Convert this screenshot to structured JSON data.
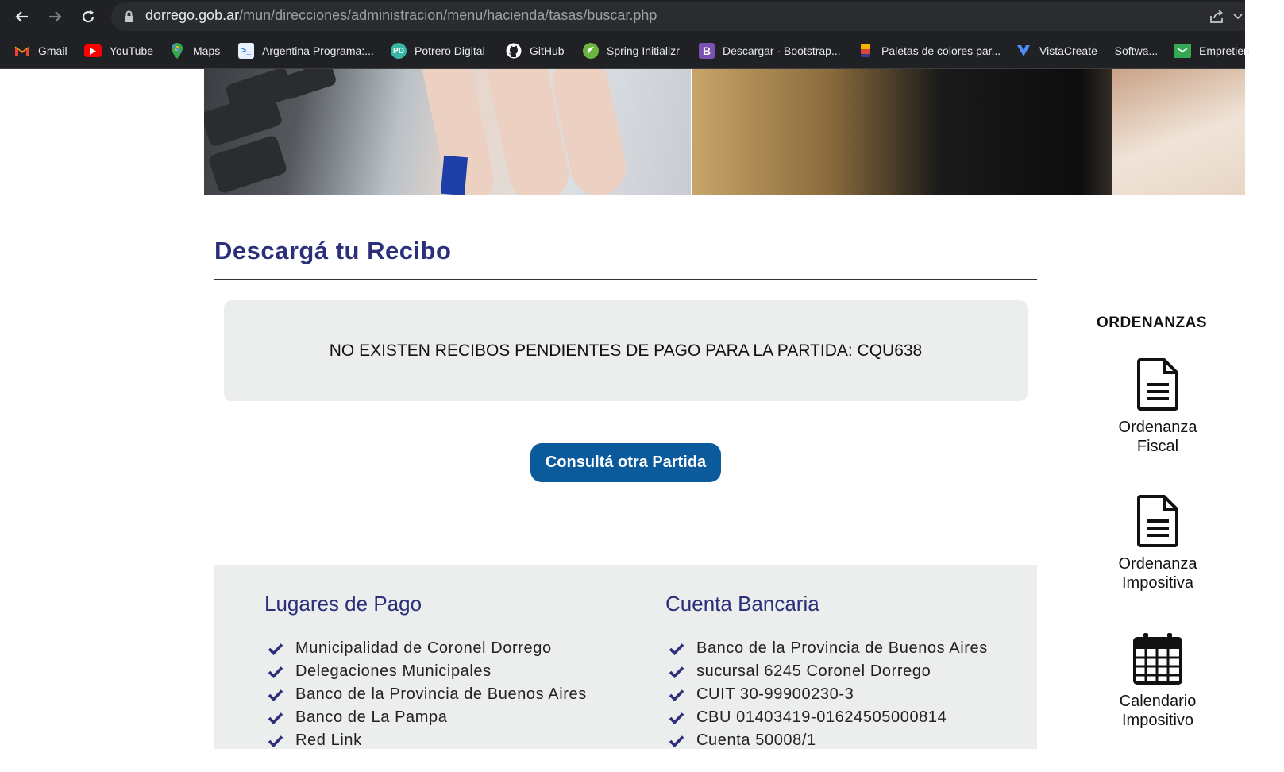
{
  "browser": {
    "url_host": "dorrego.gob.ar",
    "url_path": "/mun/direcciones/administracion/menu/hacienda/tasas/buscar.php",
    "bookmarks": [
      {
        "label": "Gmail",
        "icon": "gmail-icon"
      },
      {
        "label": "YouTube",
        "icon": "youtube-icon"
      },
      {
        "label": "Maps",
        "icon": "maps-icon"
      },
      {
        "label": "Argentina Programa:...",
        "icon": "terminal-icon"
      },
      {
        "label": "Potrero Digital",
        "icon": "pd-icon"
      },
      {
        "label": "GitHub",
        "icon": "github-icon"
      },
      {
        "label": "Spring Initializr",
        "icon": "spring-icon"
      },
      {
        "label": "Descargar · Bootstrap...",
        "icon": "bootstrap-icon"
      },
      {
        "label": "Paletas de colores par...",
        "icon": "palette-icon"
      },
      {
        "label": "VistaCreate — Softwa...",
        "icon": "vistacreate-icon"
      },
      {
        "label": "Empretien",
        "icon": "folder-icon"
      }
    ]
  },
  "page": {
    "title": "Descargá tu Recibo",
    "alert": "NO EXISTEN RECIBOS PENDIENTES DE PAGO PARA LA PARTIDA: CQU638",
    "button": "Consultá otra Partida"
  },
  "payment": {
    "title": "Lugares de Pago",
    "items": [
      "Municipalidad de Coronel Dorrego",
      "Delegaciones Municipales",
      "Banco de la Provincia de Buenos Aires",
      "Banco de La Pampa",
      "Red Link"
    ]
  },
  "bank": {
    "title": "Cuenta Bancaria",
    "items": [
      "Banco de la Provincia de Buenos Aires",
      "sucursal 6245 Coronel Dorrego",
      "CUIT 30-99900230-3",
      "CBU 01403419-01624505000814",
      "Cuenta 50008/1"
    ]
  },
  "sidebar": {
    "title": "ORDENANZAS",
    "items": [
      {
        "line1": "Ordenanza",
        "line2": "Fiscal",
        "icon": "document-icon"
      },
      {
        "line1": "Ordenanza",
        "line2": "Impositiva",
        "icon": "document-icon"
      },
      {
        "line1": "Calendario",
        "line2": "Impositivo",
        "icon": "calendar-icon"
      }
    ]
  },
  "colors": {
    "heading": "#2c2f7a",
    "button": "#0b5a9c",
    "panel": "#eceded",
    "chrome": "#202124"
  }
}
